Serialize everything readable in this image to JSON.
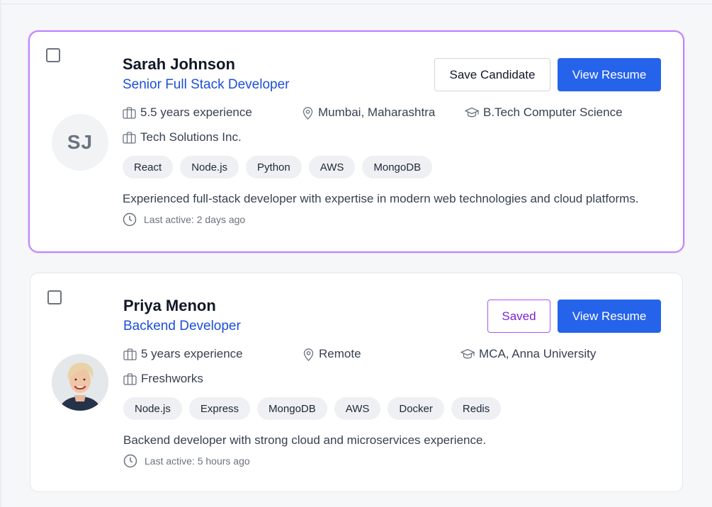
{
  "candidates": [
    {
      "initials": "SJ",
      "name": "Sarah Johnson",
      "role": "Senior Full Stack Developer",
      "experience": "5.5 years experience",
      "location": "Mumbai, Maharashtra",
      "education": "B.Tech Computer Science",
      "company": "Tech Solutions Inc.",
      "skills": [
        "React",
        "Node.js",
        "Python",
        "AWS",
        "MongoDB"
      ],
      "summary": "Experienced full-stack developer with expertise in modern web technologies and cloud platforms.",
      "last_active": "Last active: 2 days ago",
      "save_label": "Save Candidate",
      "view_label": "View Resume"
    },
    {
      "name": "Priya Menon",
      "role": "Backend Developer",
      "experience": "5 years experience",
      "location": "Remote",
      "education": "MCA, Anna University",
      "company": "Freshworks",
      "skills": [
        "Node.js",
        "Express",
        "MongoDB",
        "AWS",
        "Docker",
        "Redis"
      ],
      "summary": "Backend developer with strong cloud and microservices experience.",
      "last_active": "Last active: 5 hours ago",
      "save_label": "Saved",
      "view_label": "View Resume"
    }
  ],
  "colors": {
    "accent": "#2563eb",
    "role_text": "#1d4fd8",
    "selected_border": "#c084fc",
    "saved_text": "#7e22ce"
  },
  "icons": {
    "experience": "briefcase-icon",
    "location": "map-pin-icon",
    "education": "graduation-cap-icon",
    "company": "building-icon",
    "last_active": "clock-icon"
  }
}
